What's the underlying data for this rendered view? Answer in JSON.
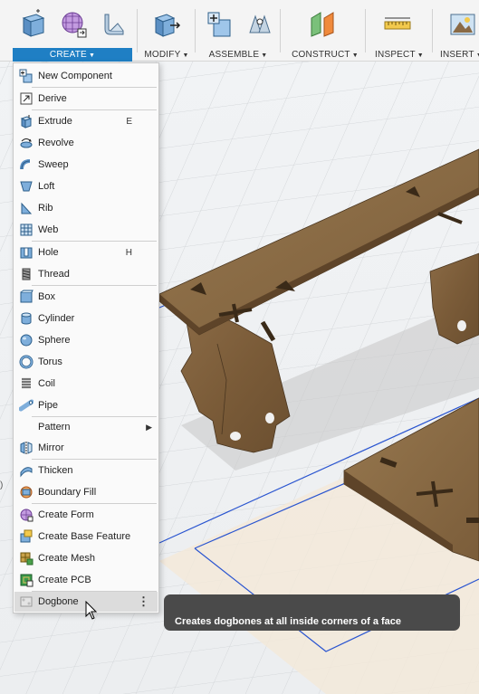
{
  "toolbar": {
    "groups": [
      {
        "label": "CREATE",
        "active": true
      },
      {
        "label": "MODIFY",
        "active": false
      },
      {
        "label": "ASSEMBLE",
        "active": false
      },
      {
        "label": "CONSTRUCT",
        "active": false
      },
      {
        "label": "INSPECT",
        "active": false
      },
      {
        "label": "INSERT",
        "active": false
      }
    ],
    "caret": "▼",
    "accent_color": "#1f7fc4"
  },
  "create_menu": {
    "items": [
      {
        "label": "New Component",
        "icon": "new-component-icon",
        "shortcut": ""
      },
      {
        "label": "Derive",
        "icon": "derive-icon",
        "shortcut": ""
      },
      {
        "label": "Extrude",
        "icon": "extrude-icon",
        "shortcut": "E"
      },
      {
        "label": "Revolve",
        "icon": "revolve-icon",
        "shortcut": ""
      },
      {
        "label": "Sweep",
        "icon": "sweep-icon",
        "shortcut": ""
      },
      {
        "label": "Loft",
        "icon": "loft-icon",
        "shortcut": ""
      },
      {
        "label": "Rib",
        "icon": "rib-icon",
        "shortcut": ""
      },
      {
        "label": "Web",
        "icon": "web-icon",
        "shortcut": ""
      },
      {
        "label": "Hole",
        "icon": "hole-icon",
        "shortcut": "H"
      },
      {
        "label": "Thread",
        "icon": "thread-icon",
        "shortcut": ""
      },
      {
        "label": "Box",
        "icon": "box-icon",
        "shortcut": ""
      },
      {
        "label": "Cylinder",
        "icon": "cylinder-icon",
        "shortcut": ""
      },
      {
        "label": "Sphere",
        "icon": "sphere-icon",
        "shortcut": ""
      },
      {
        "label": "Torus",
        "icon": "torus-icon",
        "shortcut": ""
      },
      {
        "label": "Coil",
        "icon": "coil-icon",
        "shortcut": ""
      },
      {
        "label": "Pipe",
        "icon": "pipe-icon",
        "shortcut": ""
      },
      {
        "label": "Pattern",
        "icon": "",
        "shortcut": "",
        "submenu": "▶"
      },
      {
        "label": "Mirror",
        "icon": "mirror-icon",
        "shortcut": ""
      },
      {
        "label": "Thicken",
        "icon": "thicken-icon",
        "shortcut": ""
      },
      {
        "label": "Boundary Fill",
        "icon": "boundary-fill-icon",
        "shortcut": ""
      },
      {
        "label": "Create Form",
        "icon": "create-form-icon",
        "shortcut": ""
      },
      {
        "label": "Create Base Feature",
        "icon": "create-base-feature-icon",
        "shortcut": ""
      },
      {
        "label": "Create Mesh",
        "icon": "create-mesh-icon",
        "shortcut": ""
      },
      {
        "label": "Create PCB",
        "icon": "create-pcb-icon",
        "shortcut": ""
      },
      {
        "label": "Dogbone",
        "icon": "dogbone-icon",
        "shortcut": "",
        "more": "⋮",
        "hovered": true
      }
    ]
  },
  "tooltip": {
    "text": "Creates dogbones at all inside corners of a face"
  },
  "left_edge_glyph": ")"
}
